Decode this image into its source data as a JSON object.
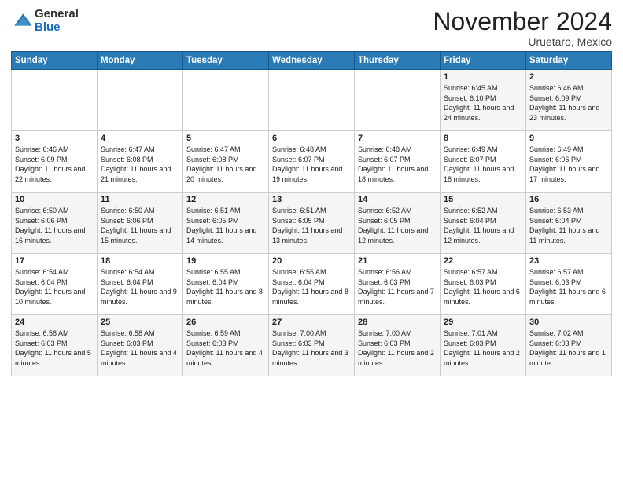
{
  "logo": {
    "general": "General",
    "blue": "Blue"
  },
  "title": "November 2024",
  "location": "Uruetaro, Mexico",
  "days_of_week": [
    "Sunday",
    "Monday",
    "Tuesday",
    "Wednesday",
    "Thursday",
    "Friday",
    "Saturday"
  ],
  "weeks": [
    [
      {
        "day": "",
        "info": ""
      },
      {
        "day": "",
        "info": ""
      },
      {
        "day": "",
        "info": ""
      },
      {
        "day": "",
        "info": ""
      },
      {
        "day": "",
        "info": ""
      },
      {
        "day": "1",
        "info": "Sunrise: 6:45 AM\nSunset: 6:10 PM\nDaylight: 11 hours and 24 minutes."
      },
      {
        "day": "2",
        "info": "Sunrise: 6:46 AM\nSunset: 6:09 PM\nDaylight: 11 hours and 23 minutes."
      }
    ],
    [
      {
        "day": "3",
        "info": "Sunrise: 6:46 AM\nSunset: 6:09 PM\nDaylight: 11 hours and 22 minutes."
      },
      {
        "day": "4",
        "info": "Sunrise: 6:47 AM\nSunset: 6:08 PM\nDaylight: 11 hours and 21 minutes."
      },
      {
        "day": "5",
        "info": "Sunrise: 6:47 AM\nSunset: 6:08 PM\nDaylight: 11 hours and 20 minutes."
      },
      {
        "day": "6",
        "info": "Sunrise: 6:48 AM\nSunset: 6:07 PM\nDaylight: 11 hours and 19 minutes."
      },
      {
        "day": "7",
        "info": "Sunrise: 6:48 AM\nSunset: 6:07 PM\nDaylight: 11 hours and 18 minutes."
      },
      {
        "day": "8",
        "info": "Sunrise: 6:49 AM\nSunset: 6:07 PM\nDaylight: 11 hours and 18 minutes."
      },
      {
        "day": "9",
        "info": "Sunrise: 6:49 AM\nSunset: 6:06 PM\nDaylight: 11 hours and 17 minutes."
      }
    ],
    [
      {
        "day": "10",
        "info": "Sunrise: 6:50 AM\nSunset: 6:06 PM\nDaylight: 11 hours and 16 minutes."
      },
      {
        "day": "11",
        "info": "Sunrise: 6:50 AM\nSunset: 6:06 PM\nDaylight: 11 hours and 15 minutes."
      },
      {
        "day": "12",
        "info": "Sunrise: 6:51 AM\nSunset: 6:05 PM\nDaylight: 11 hours and 14 minutes."
      },
      {
        "day": "13",
        "info": "Sunrise: 6:51 AM\nSunset: 6:05 PM\nDaylight: 11 hours and 13 minutes."
      },
      {
        "day": "14",
        "info": "Sunrise: 6:52 AM\nSunset: 6:05 PM\nDaylight: 11 hours and 12 minutes."
      },
      {
        "day": "15",
        "info": "Sunrise: 6:52 AM\nSunset: 6:04 PM\nDaylight: 11 hours and 12 minutes."
      },
      {
        "day": "16",
        "info": "Sunrise: 6:53 AM\nSunset: 6:04 PM\nDaylight: 11 hours and 11 minutes."
      }
    ],
    [
      {
        "day": "17",
        "info": "Sunrise: 6:54 AM\nSunset: 6:04 PM\nDaylight: 11 hours and 10 minutes."
      },
      {
        "day": "18",
        "info": "Sunrise: 6:54 AM\nSunset: 6:04 PM\nDaylight: 11 hours and 9 minutes."
      },
      {
        "day": "19",
        "info": "Sunrise: 6:55 AM\nSunset: 6:04 PM\nDaylight: 11 hours and 8 minutes."
      },
      {
        "day": "20",
        "info": "Sunrise: 6:55 AM\nSunset: 6:04 PM\nDaylight: 11 hours and 8 minutes."
      },
      {
        "day": "21",
        "info": "Sunrise: 6:56 AM\nSunset: 6:03 PM\nDaylight: 11 hours and 7 minutes."
      },
      {
        "day": "22",
        "info": "Sunrise: 6:57 AM\nSunset: 6:03 PM\nDaylight: 11 hours and 6 minutes."
      },
      {
        "day": "23",
        "info": "Sunrise: 6:57 AM\nSunset: 6:03 PM\nDaylight: 11 hours and 6 minutes."
      }
    ],
    [
      {
        "day": "24",
        "info": "Sunrise: 6:58 AM\nSunset: 6:03 PM\nDaylight: 11 hours and 5 minutes."
      },
      {
        "day": "25",
        "info": "Sunrise: 6:58 AM\nSunset: 6:03 PM\nDaylight: 11 hours and 4 minutes."
      },
      {
        "day": "26",
        "info": "Sunrise: 6:59 AM\nSunset: 6:03 PM\nDaylight: 11 hours and 4 minutes."
      },
      {
        "day": "27",
        "info": "Sunrise: 7:00 AM\nSunset: 6:03 PM\nDaylight: 11 hours and 3 minutes."
      },
      {
        "day": "28",
        "info": "Sunrise: 7:00 AM\nSunset: 6:03 PM\nDaylight: 11 hours and 2 minutes."
      },
      {
        "day": "29",
        "info": "Sunrise: 7:01 AM\nSunset: 6:03 PM\nDaylight: 11 hours and 2 minutes."
      },
      {
        "day": "30",
        "info": "Sunrise: 7:02 AM\nSunset: 6:03 PM\nDaylight: 11 hours and 1 minute."
      }
    ]
  ]
}
